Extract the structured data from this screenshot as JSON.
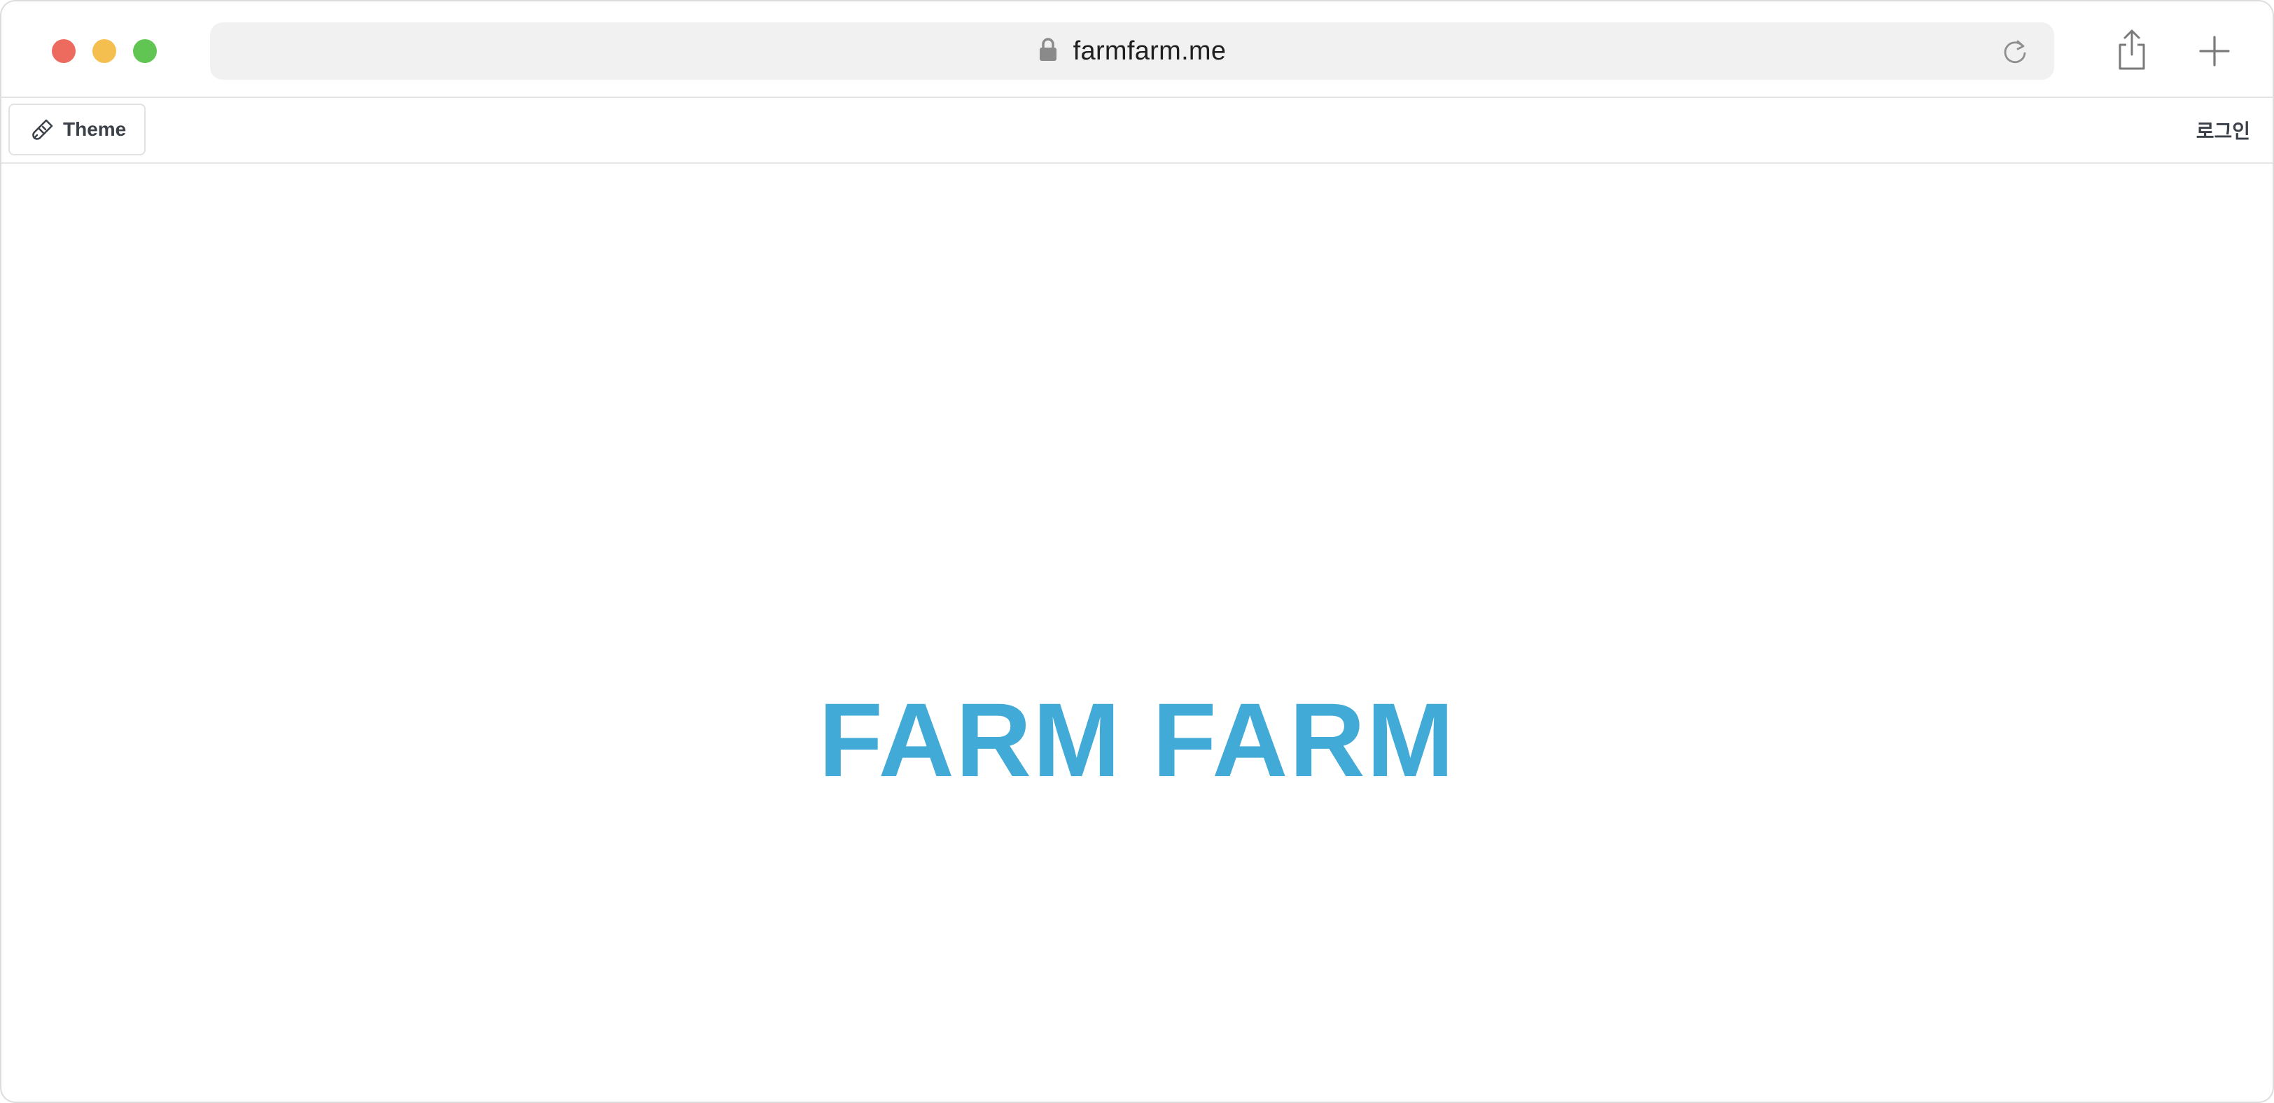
{
  "browser": {
    "url": "farmfarm.me",
    "icons": {
      "lock": "lock-icon",
      "reload": "reload-icon",
      "share": "share-icon",
      "new_tab": "plus-icon"
    },
    "traffic_lights": {
      "close": "#ed6a5e",
      "minimize": "#f5bf4f",
      "maximize": "#61c554"
    }
  },
  "header": {
    "theme_button": {
      "label": "Theme",
      "icon": "brush-icon"
    },
    "login_label": "로그인"
  },
  "main": {
    "title": "FARM FARM",
    "title_color": "#42aad6"
  }
}
